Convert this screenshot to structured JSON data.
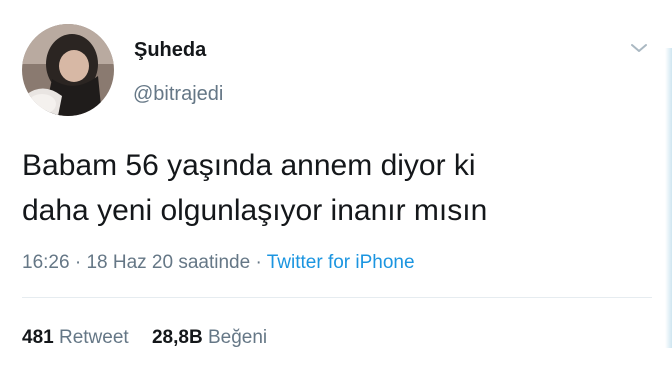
{
  "tweet": {
    "author": {
      "display_name": "Şuheda",
      "handle": "@bitrajedi",
      "avatar": "avatar-photo"
    },
    "text_lines": [
      "Babam 56 yaşında annem diyor ki",
      "daha yeni olgunlaşıyor inanır mısın"
    ],
    "time": "16:26",
    "separator": "·",
    "date": "18 Haz 20 saatinde",
    "source": "Twitter for iPhone",
    "stats": {
      "retweets_count": "481",
      "retweets_label": "Retweet",
      "likes_count": "28,8B",
      "likes_label": "Beğeni"
    },
    "menu_icon": "chevron-down-icon"
  },
  "colors": {
    "text": "#14171a",
    "secondary": "#657786",
    "link": "#1b95e0",
    "divider": "#e6ecf0"
  }
}
